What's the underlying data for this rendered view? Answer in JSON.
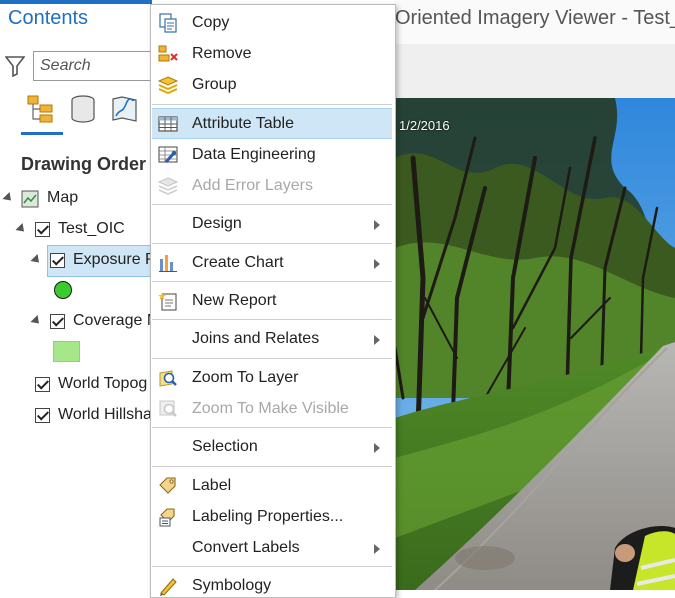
{
  "contents": {
    "title": "Contents",
    "search_placeholder": "Search",
    "drawing_order": "Drawing Order",
    "layers": {
      "map": "Map",
      "test_oic": "Test_OIC",
      "exposure": "Exposure P",
      "coverage": "Coverage M",
      "topo": "World Topog",
      "hillshade": "World Hillsha"
    },
    "symbol_colors": {
      "exposure_point": "#3ccb2c",
      "coverage_fill": "#a6e889"
    }
  },
  "view": {
    "title": "Oriented Imagery Viewer - Test_",
    "date": "1/2/2016"
  },
  "menu": {
    "copy": "Copy",
    "remove": "Remove",
    "group": "Group",
    "attribute_table": "Attribute Table",
    "data_engineering": "Data Engineering",
    "add_error_layers": "Add Error Layers",
    "design": "Design",
    "create_chart": "Create Chart",
    "new_report": "New Report",
    "joins_relates": "Joins and Relates",
    "zoom_to_layer": "Zoom To Layer",
    "zoom_visible": "Zoom To Make Visible",
    "selection": "Selection",
    "label": "Label",
    "labeling_properties": "Labeling Properties...",
    "convert_labels": "Convert Labels",
    "symbology": "Symbology"
  },
  "colors": {
    "accent": "#1f6fc5",
    "highlight": "#cfe6f6"
  }
}
